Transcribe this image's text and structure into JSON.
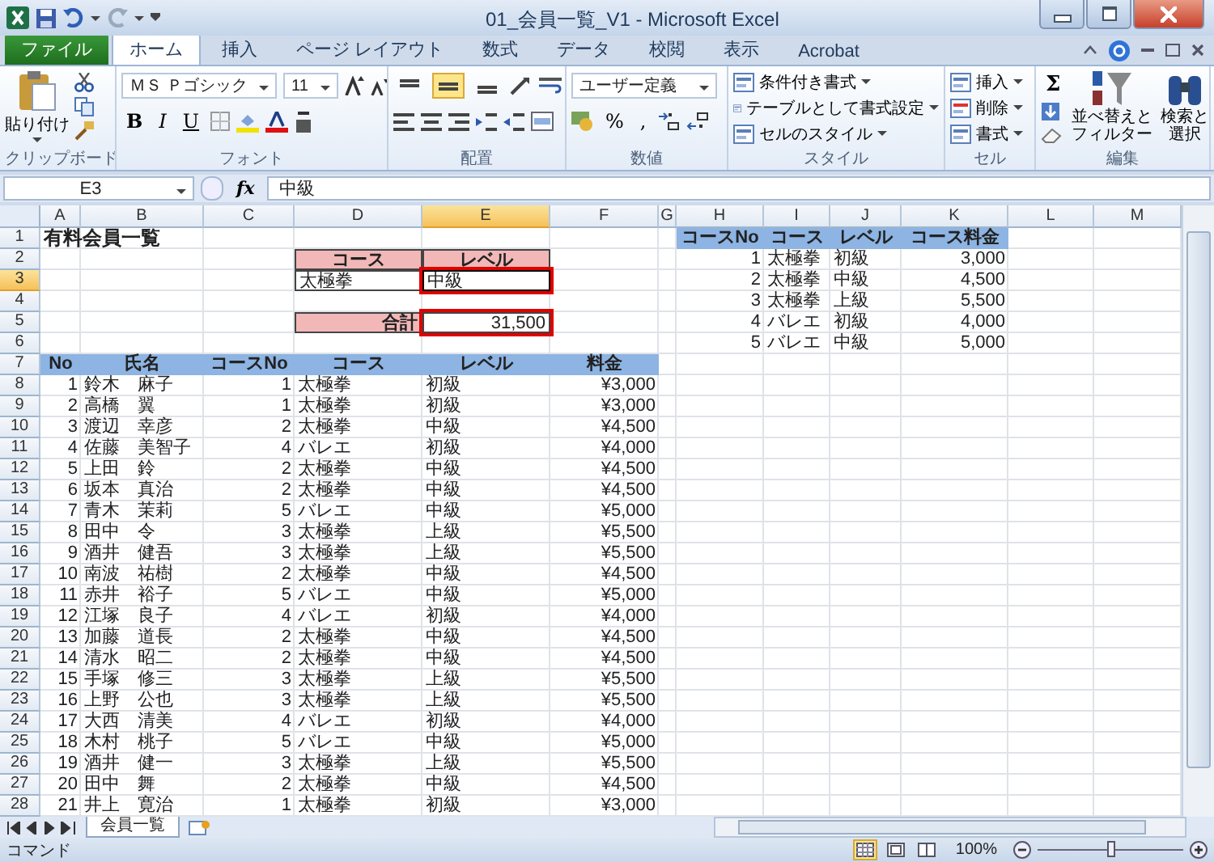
{
  "window": {
    "title": "01_会員一覧_V1 - Microsoft Excel"
  },
  "ribbon_tabs": [
    {
      "label": "ファイル",
      "kind": "file",
      "selected": false
    },
    {
      "label": "ホーム",
      "kind": "tab",
      "selected": true
    },
    {
      "label": "挿入",
      "kind": "tab",
      "selected": false
    },
    {
      "label": "ページ レイアウト",
      "kind": "tab",
      "selected": false
    },
    {
      "label": "数式",
      "kind": "tab",
      "selected": false
    },
    {
      "label": "データ",
      "kind": "tab",
      "selected": false
    },
    {
      "label": "校閲",
      "kind": "tab",
      "selected": false
    },
    {
      "label": "表示",
      "kind": "tab",
      "selected": false
    },
    {
      "label": "Acrobat",
      "kind": "tab",
      "selected": false
    }
  ],
  "ribbon_groups": [
    {
      "kind": "clipboard",
      "label": "クリップボード",
      "paste": "貼り付け"
    },
    {
      "kind": "font",
      "label": "フォント",
      "font_name": "ＭＳ Ｐゴシック",
      "font_size": "11",
      "styles": [
        "B",
        "I",
        "U"
      ]
    },
    {
      "kind": "alignment",
      "label": "配置",
      "vertical": [
        {
          "selected": false
        },
        {
          "selected": true
        },
        {
          "selected": false
        }
      ]
    },
    {
      "kind": "number",
      "label": "数値",
      "format": "ユーザー定義",
      "symbols": [
        "%",
        ","
      ]
    },
    {
      "kind": "styles",
      "label": "スタイル",
      "buttons": [
        "条件付き書式",
        "テーブルとして書式設定",
        "セルのスタイル"
      ]
    },
    {
      "kind": "cells",
      "label": "セル",
      "buttons": [
        "挿入",
        "削除",
        "書式"
      ]
    },
    {
      "kind": "editing",
      "label": "編集",
      "sum": "Σ",
      "buttons": [
        [
          "並べ替えと",
          "フィルター"
        ],
        [
          "検索と",
          "選択"
        ]
      ]
    }
  ],
  "formula_bar": {
    "name_box": "E3",
    "fx": "fx",
    "value": "中級"
  },
  "sheet": {
    "columns": [
      {
        "label": "A",
        "selected": false
      },
      {
        "label": "B",
        "selected": false
      },
      {
        "label": "C",
        "selected": false
      },
      {
        "label": "D",
        "selected": false
      },
      {
        "label": "E",
        "selected": true
      },
      {
        "label": "F",
        "selected": false
      },
      {
        "label": "G",
        "selected": false
      },
      {
        "label": "H",
        "selected": false
      },
      {
        "label": "I",
        "selected": false
      },
      {
        "label": "J",
        "selected": false
      },
      {
        "label": "K",
        "selected": false
      },
      {
        "label": "L",
        "selected": false
      },
      {
        "label": "M",
        "selected": false
      }
    ],
    "rows": [
      {
        "label": "1",
        "selected": false
      },
      {
        "label": "2",
        "selected": false
      },
      {
        "label": "3",
        "selected": true
      },
      {
        "label": "4",
        "selected": false
      },
      {
        "label": "5",
        "selected": false
      },
      {
        "label": "6",
        "selected": false
      },
      {
        "label": "7",
        "selected": false
      },
      {
        "label": "8",
        "selected": false
      },
      {
        "label": "9",
        "selected": false
      },
      {
        "label": "10",
        "selected": false
      },
      {
        "label": "11",
        "selected": false
      },
      {
        "label": "12",
        "selected": false
      },
      {
        "label": "13",
        "selected": false
      },
      {
        "label": "14",
        "selected": false
      },
      {
        "label": "15",
        "selected": false
      },
      {
        "label": "16",
        "selected": false
      },
      {
        "label": "17",
        "selected": false
      },
      {
        "label": "18",
        "selected": false
      },
      {
        "label": "19",
        "selected": false
      },
      {
        "label": "20",
        "selected": false
      },
      {
        "label": "21",
        "selected": false
      },
      {
        "label": "22",
        "selected": false
      },
      {
        "label": "23",
        "selected": false
      },
      {
        "label": "24",
        "selected": false
      },
      {
        "label": "25",
        "selected": false
      },
      {
        "label": "26",
        "selected": false
      },
      {
        "label": "27",
        "selected": false
      },
      {
        "label": "28",
        "selected": false
      }
    ],
    "title": "有料会員一覧",
    "lookup": {
      "course_heading": "コース",
      "level_heading": "レベル",
      "course": "太極拳",
      "level": "中級",
      "level_highlighted": true,
      "total_label": "合計",
      "total": "31,500",
      "total_highlighted": true
    },
    "member_table": {
      "columns": [
        {
          "label": "No",
          "kind": "number"
        },
        {
          "label": "氏名",
          "kind": "text"
        },
        {
          "label": "コースNo",
          "kind": "number"
        },
        {
          "label": "コース",
          "kind": "text"
        },
        {
          "label": "レベル",
          "kind": "text"
        },
        {
          "label": "料金",
          "kind": "number"
        }
      ],
      "rows": [
        [
          "1",
          "鈴木　麻子",
          "1",
          "太極拳",
          "初級",
          "¥3,000"
        ],
        [
          "2",
          "高橋　翼",
          "1",
          "太極拳",
          "初級",
          "¥3,000"
        ],
        [
          "3",
          "渡辺　幸彦",
          "2",
          "太極拳",
          "中級",
          "¥4,500"
        ],
        [
          "4",
          "佐藤　美智子",
          "4",
          "バレエ",
          "初級",
          "¥4,000"
        ],
        [
          "5",
          "上田　鈴",
          "2",
          "太極拳",
          "中級",
          "¥4,500"
        ],
        [
          "6",
          "坂本　真治",
          "2",
          "太極拳",
          "中級",
          "¥4,500"
        ],
        [
          "7",
          "青木　茉莉",
          "5",
          "バレエ",
          "中級",
          "¥5,000"
        ],
        [
          "8",
          "田中　令",
          "3",
          "太極拳",
          "上級",
          "¥5,500"
        ],
        [
          "9",
          "酒井　健吾",
          "3",
          "太極拳",
          "上級",
          "¥5,500"
        ],
        [
          "10",
          "南波　祐樹",
          "2",
          "太極拳",
          "中級",
          "¥4,500"
        ],
        [
          "11",
          "赤井　裕子",
          "5",
          "バレエ",
          "中級",
          "¥5,000"
        ],
        [
          "12",
          "江塚　良子",
          "4",
          "バレエ",
          "初級",
          "¥4,000"
        ],
        [
          "13",
          "加藤　道長",
          "2",
          "太極拳",
          "中級",
          "¥4,500"
        ],
        [
          "14",
          "清水　昭二",
          "2",
          "太極拳",
          "中級",
          "¥4,500"
        ],
        [
          "15",
          "手塚　修三",
          "3",
          "太極拳",
          "上級",
          "¥5,500"
        ],
        [
          "16",
          "上野　公也",
          "3",
          "太極拳",
          "上級",
          "¥5,500"
        ],
        [
          "17",
          "大西　清美",
          "4",
          "バレエ",
          "初級",
          "¥4,000"
        ],
        [
          "18",
          "木村　桃子",
          "5",
          "バレエ",
          "中級",
          "¥5,000"
        ],
        [
          "19",
          "酒井　健一",
          "3",
          "太極拳",
          "上級",
          "¥5,500"
        ],
        [
          "20",
          "田中　舞",
          "2",
          "太極拳",
          "中級",
          "¥4,500"
        ],
        [
          "21",
          "井上　寛治",
          "1",
          "太極拳",
          "初級",
          "¥3,000"
        ]
      ]
    },
    "course_table": {
      "columns": [
        {
          "label": "コースNo",
          "kind": "number"
        },
        {
          "label": "コース",
          "kind": "text"
        },
        {
          "label": "レベル",
          "kind": "text"
        },
        {
          "label": "コース料金",
          "kind": "number"
        }
      ],
      "rows": [
        [
          "1",
          "太極拳",
          "初級",
          "3,000"
        ],
        [
          "2",
          "太極拳",
          "中級",
          "4,500"
        ],
        [
          "3",
          "太極拳",
          "上級",
          "5,500"
        ],
        [
          "4",
          "バレエ",
          "初級",
          "4,000"
        ],
        [
          "5",
          "バレエ",
          "中級",
          "5,000"
        ]
      ]
    }
  },
  "sheet_tabs": [
    {
      "label": "会員一覧",
      "selected": true
    }
  ],
  "status_bar": {
    "mode": "コマンド",
    "views": [
      {
        "selected": true
      },
      {
        "selected": false
      },
      {
        "selected": false
      }
    ],
    "zoom": "100%",
    "zoom_slider": {
      "level": 0.5
    }
  }
}
